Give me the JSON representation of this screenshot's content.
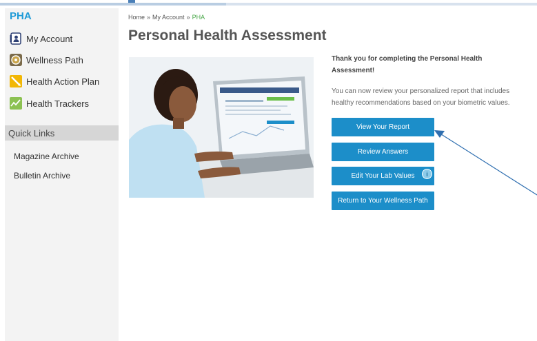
{
  "sidebar": {
    "title": "PHA",
    "items": [
      {
        "label": "My Account",
        "icon": "account-icon"
      },
      {
        "label": "Wellness Path",
        "icon": "wellness-path-icon"
      },
      {
        "label": "Health Action Plan",
        "icon": "health-action-plan-icon"
      },
      {
        "label": "Health Trackers",
        "icon": "health-trackers-icon"
      }
    ],
    "quick_links_heading": "Quick Links",
    "quick_links": [
      {
        "label": "Magazine Archive"
      },
      {
        "label": "Bulletin Archive"
      }
    ]
  },
  "breadcrumb": {
    "home": "Home",
    "account": "My Account",
    "current": "PHA",
    "separator": "»"
  },
  "main": {
    "title": "Personal Health Assessment",
    "thanks": "Thank you for completing the Personal Health Assessment!",
    "description": "You can now review your personalized report that includes healthy recommendations based on your biometric values.",
    "buttons": {
      "view_report": "View Your Report",
      "review_answers": "Review Answers",
      "edit_lab_values": "Edit Your Lab Values",
      "return_wellness": "Return to Your Wellness Path"
    },
    "info_badge": "i"
  },
  "colors": {
    "accent": "#1c8ec9",
    "title_blue": "#1f9bd7",
    "breadcrumb_current": "#4aa84a"
  }
}
